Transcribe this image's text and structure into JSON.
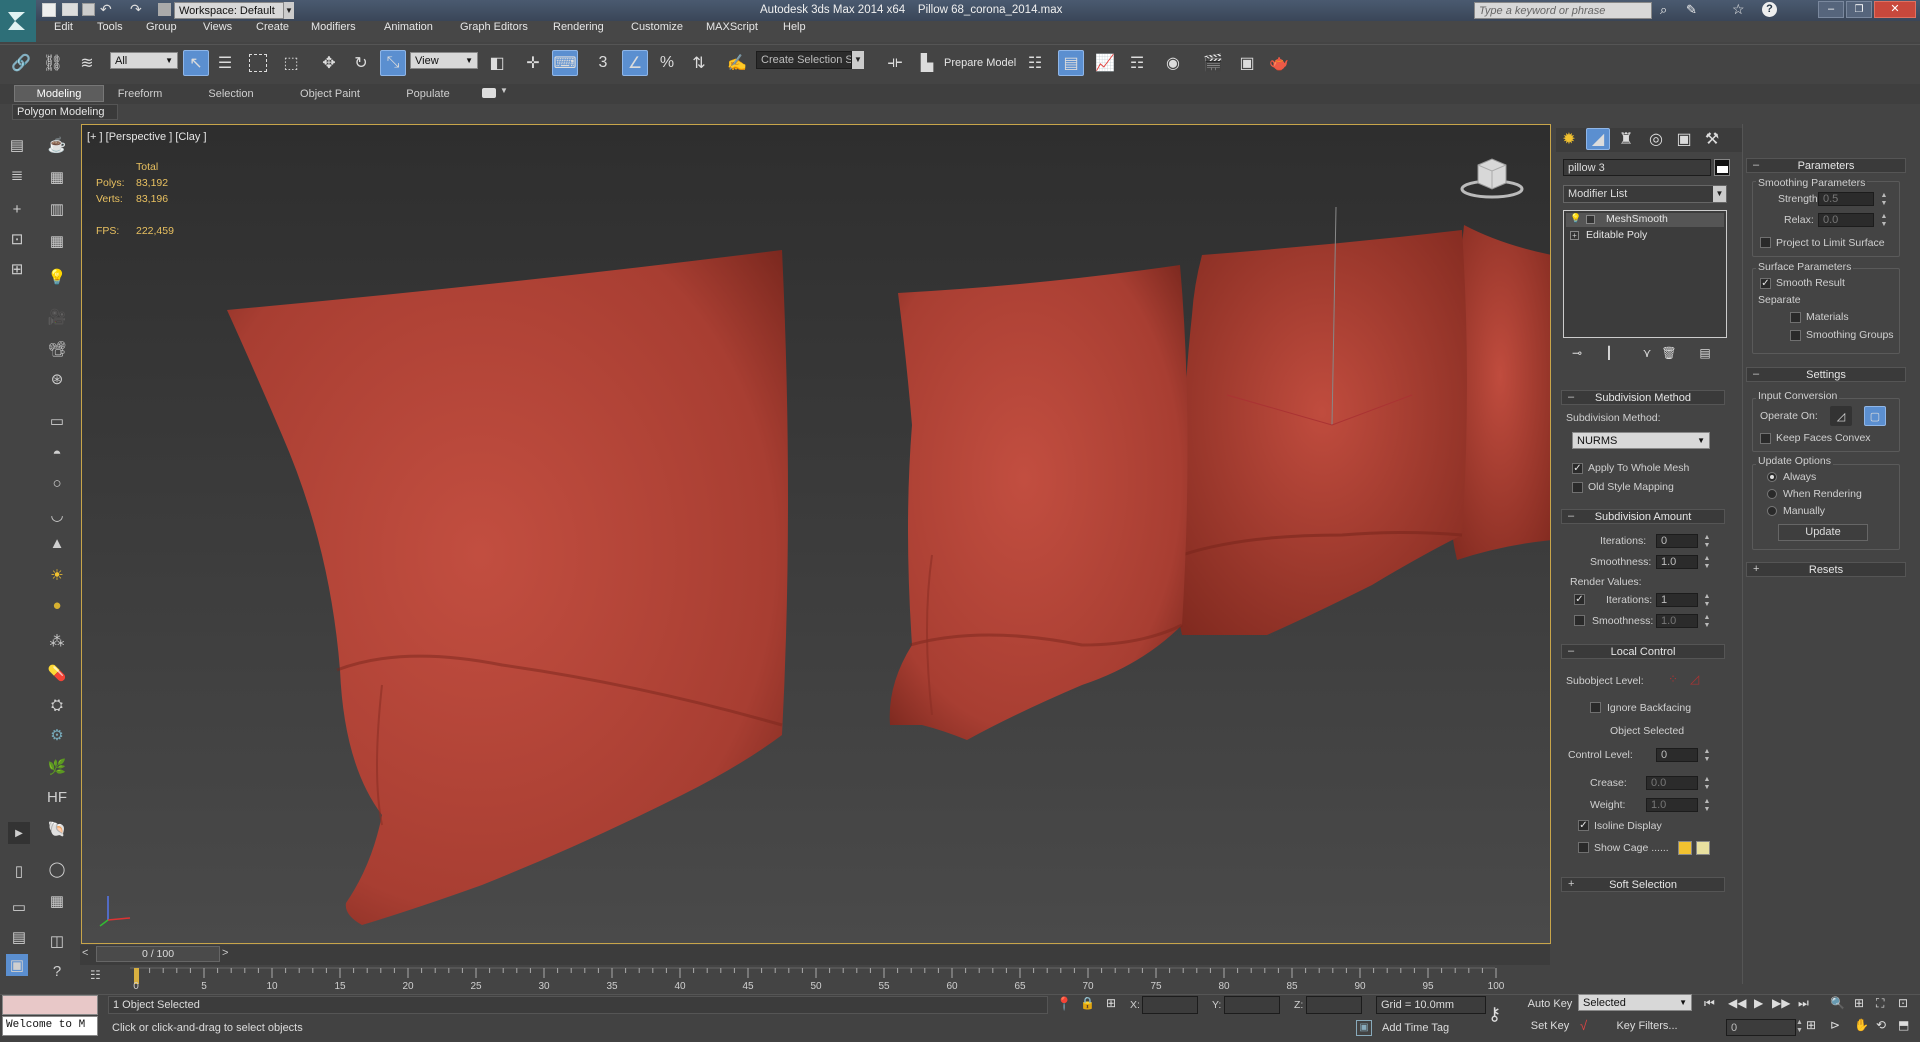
{
  "title_bar": {
    "app_title": "Autodesk 3ds Max  2014 x64",
    "file_name": "Pillow 68_corona_2014.max",
    "workspace": "Workspace: Default",
    "search_placeholder": "Type a keyword or phrase"
  },
  "menu": [
    "Edit",
    "Tools",
    "Group",
    "Views",
    "Create",
    "Modifiers",
    "Animation",
    "Graph Editors",
    "Rendering",
    "Customize",
    "MAXScript",
    "Help"
  ],
  "toolbar": {
    "selection_filter": "All",
    "ref_coord": "View",
    "named_selection": "Create Selection Se",
    "prepare_model": "Prepare Model"
  },
  "ribbon": {
    "tabs": [
      "Modeling",
      "Freeform",
      "Selection",
      "Object Paint",
      "Populate"
    ],
    "active_tab": "Modeling",
    "sub_label": "Polygon Modeling"
  },
  "viewport": {
    "label": "[+ ] [Perspective ] [Clay ]",
    "stats_header": "Total",
    "polys_label": "Polys:",
    "polys_value": "83,192",
    "verts_label": "Verts:",
    "verts_value": "83,196",
    "fps_label": "FPS:",
    "fps_value": "222,459",
    "background_color": "#3a3a3a",
    "pillow_color": "#b5463a"
  },
  "command_panel": {
    "object_name": "pillow 3",
    "modifier_list": "Modifier List",
    "stack": [
      "MeshSmooth",
      "Editable Poly"
    ],
    "subdivision_method": {
      "title": "Subdivision Method",
      "label": "Subdivision Method:",
      "value": "NURMS",
      "apply_whole_mesh": "Apply To Whole Mesh",
      "old_style": "Old Style Mapping"
    },
    "subdivision_amount": {
      "title": "Subdivision Amount",
      "iterations_label": "Iterations:",
      "iterations_value": "0",
      "smoothness_label": "Smoothness:",
      "smoothness_value": "1.0",
      "render_values": "Render Values:",
      "r_iterations_label": "Iterations:",
      "r_iterations_value": "1",
      "r_smoothness_label": "Smoothness:",
      "r_smoothness_value": "1.0"
    },
    "local_control": {
      "title": "Local Control",
      "subobject_level": "Subobject Level:",
      "ignore_backfacing": "Ignore Backfacing",
      "object_selected": "Object Selected",
      "control_level_label": "Control Level:",
      "control_level_value": "0",
      "crease_label": "Crease:",
      "crease_value": "0.0",
      "weight_label": "Weight:",
      "weight_value": "1.0",
      "isoline_display": "Isoline Display",
      "show_cage": "Show Cage ......"
    },
    "soft_selection": "Soft Selection"
  },
  "right_panel": {
    "parameters_title": "Parameters",
    "smoothing_params": "Smoothing Parameters",
    "strength_label": "Strength:",
    "strength_value": "0.5",
    "relax_label": "Relax:",
    "relax_value": "0.0",
    "project_limit": "Project to Limit Surface",
    "surface_params": "Surface Parameters",
    "smooth_result": "Smooth Result",
    "separate": "Separate",
    "materials": "Materials",
    "smoothing_groups": "Smoothing Groups",
    "settings_title": "Settings",
    "input_conversion": "Input Conversion",
    "operate_on": "Operate On:",
    "keep_faces_convex": "Keep Faces Convex",
    "update_options": "Update Options",
    "always": "Always",
    "when_rendering": "When Rendering",
    "manually": "Manually",
    "update_button": "Update",
    "resets_title": "Resets"
  },
  "timeline": {
    "frame_display": "0 / 100",
    "ticks": [
      "0",
      "5",
      "10",
      "15",
      "20",
      "25",
      "30",
      "35",
      "40",
      "45",
      "50",
      "55",
      "60",
      "65",
      "70",
      "75",
      "80",
      "85",
      "90",
      "95",
      "100"
    ]
  },
  "status_bar": {
    "maxscript_listener": "Welcome to M",
    "selection_status": "1 Object Selected",
    "prompt": "Click or click-and-drag to select objects",
    "x_label": "X:",
    "y_label": "Y:",
    "z_label": "Z:",
    "grid": "Grid = 10.0mm",
    "add_time_tag": "Add Time Tag",
    "auto_key": "Auto Key",
    "set_key": "Set Key",
    "key_mode": "Selected",
    "key_filters": "Key Filters...",
    "current_frame": "0"
  },
  "colors": {
    "accent_blue": "#5b8fd0",
    "cage_yellow": "#f2c230",
    "cage_pale": "#e8e0a0"
  }
}
